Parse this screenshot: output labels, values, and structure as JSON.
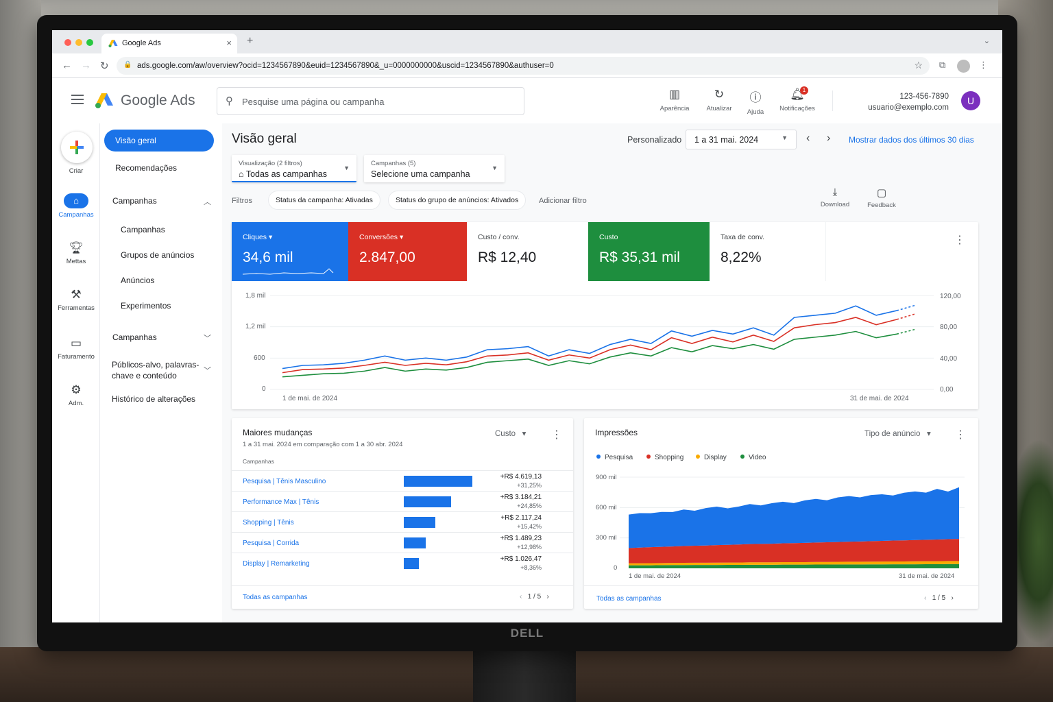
{
  "browser": {
    "tab_title": "Google Ads",
    "url": "ads.google.com/aw/overview?ocid=1234567890&euid=1234567890&_u=0000000000&uscid=1234567890&authuser=0"
  },
  "header": {
    "product": "Google Ads",
    "search_placeholder": "Pesquise uma página ou campanha",
    "buttons": [
      "Aparência",
      "Atualizar",
      "Ajuda",
      "Notificações"
    ],
    "notif_count": "1",
    "account_id": "123-456-7890",
    "account_email": "usuario@exemplo.com",
    "avatar_letter": "U"
  },
  "rail": {
    "create": "Criar",
    "items": [
      "Campanhas",
      "Mettas",
      "Ferramentas",
      "Faturamento",
      "Adm."
    ]
  },
  "nav": {
    "items": [
      "Visão geral",
      "Recomendações",
      "Campanhas",
      "Campanhas",
      "Grupos de anúncios",
      "Anúncios",
      "Experimentos",
      "Campanhas",
      "Públicos-alvo, palavras-",
      "chave e conteúdo",
      "Histórico de alterações"
    ]
  },
  "page": {
    "title": "Visão geral",
    "range_label": "Personalizado",
    "date_range": "1 a 31 mai. 2024",
    "last30": "Mostrar dados dos últimos 30 dias",
    "view_sub": "Visualização (2 filtros)",
    "view_val": "Todas as campanhas",
    "camp_sub": "Campanhas (5)",
    "camp_val": "Selecione uma campanha",
    "filters_label": "Filtros",
    "chip1": "Status da campanha: Ativadas",
    "chip2": "Status do grupo de anúncios: Ativados",
    "add_filter": "Adicionar filtro",
    "download": "Download",
    "feedback": "Feedback"
  },
  "metrics": [
    {
      "name": "Cliques",
      "value": "34,6 mil",
      "color": "#1a73e8"
    },
    {
      "name": "Conversões",
      "value": "2.847,00",
      "color": "#d93025"
    },
    {
      "name": "Custo / conv.",
      "value": "R$ 12,40",
      "color": "#ffffff"
    },
    {
      "name": "Custo",
      "value": "R$ 35,31 mil",
      "color": "#1e8e3e"
    },
    {
      "name": "Taxa de conv.",
      "value": "8,22%",
      "color": "#ffffff"
    }
  ],
  "chart_data": [
    {
      "type": "line",
      "x_start_label": "1 de mai. de 2024",
      "x_end_label": "31 de mai. de 2024",
      "y_left_ticks": [
        "0",
        "600",
        "1,2 mil",
        "1,8 mil"
      ],
      "y_right_ticks": [
        "0,00",
        "40,00",
        "80,00",
        "120,00"
      ],
      "ylim": [
        0,
        1800
      ],
      "series": [
        {
          "color": "#1a73e8",
          "values": [
            400,
            460,
            470,
            500,
            560,
            640,
            560,
            600,
            560,
            620,
            760,
            780,
            820,
            640,
            760,
            690,
            860,
            960,
            880,
            1120,
            1020,
            1130,
            1060,
            1180,
            1040,
            1380,
            1420,
            1460,
            1600,
            1420,
            1510
          ]
        },
        {
          "color": "#d93025",
          "values": [
            320,
            380,
            390,
            410,
            460,
            520,
            460,
            500,
            470,
            530,
            640,
            660,
            700,
            560,
            660,
            600,
            760,
            850,
            760,
            990,
            880,
            1000,
            910,
            1040,
            920,
            1180,
            1240,
            1280,
            1380,
            1240,
            1340
          ]
        },
        {
          "color": "#1e8e3e",
          "values": [
            240,
            270,
            300,
            310,
            350,
            420,
            350,
            390,
            370,
            420,
            520,
            550,
            580,
            460,
            550,
            490,
            620,
            700,
            640,
            800,
            720,
            840,
            780,
            860,
            770,
            960,
            1000,
            1040,
            1110,
            990,
            1060
          ]
        }
      ]
    },
    {
      "type": "area",
      "x_start_label": "1 de mai. de 2024",
      "x_end_label": "31 de mai. de 2024",
      "y_ticks": [
        "0",
        "300 mil",
        "600 mil",
        "900 mil"
      ],
      "ylim": [
        0,
        900
      ],
      "series": [
        {
          "name": "Video",
          "color": "#1e8e3e",
          "values": [
            30,
            30,
            30,
            31,
            32,
            32,
            33,
            33,
            33,
            34,
            34,
            35,
            35,
            35,
            36,
            36,
            36,
            37,
            37,
            38,
            38,
            38,
            39,
            39,
            40,
            40,
            40,
            41,
            41,
            42,
            42
          ]
        },
        {
          "name": "Display",
          "color": "#f9ab00",
          "values": [
            20,
            20,
            21,
            21,
            21,
            22,
            22,
            22,
            23,
            23,
            23,
            24,
            24,
            24,
            25,
            25,
            25,
            26,
            26,
            26,
            27,
            27,
            27,
            28,
            28,
            28,
            29,
            29,
            29,
            30,
            30
          ]
        },
        {
          "name": "Shopping",
          "color": "#d93025",
          "values": [
            150,
            155,
            158,
            160,
            163,
            166,
            168,
            170,
            173,
            175,
            178,
            180,
            182,
            184,
            186,
            188,
            190,
            192,
            194,
            196,
            198,
            200,
            202,
            204,
            206,
            208,
            210,
            212,
            214,
            216,
            218
          ]
        },
        {
          "name": "Pesquisa",
          "color": "#1a73e8",
          "values": [
            330,
            340,
            335,
            345,
            340,
            360,
            345,
            370,
            380,
            360,
            375,
            395,
            380,
            400,
            410,
            395,
            420,
            430,
            415,
            440,
            450,
            435,
            455,
            460,
            445,
            470,
            480,
            465,
            500,
            470,
            510
          ]
        }
      ]
    },
    {
      "type": "bar",
      "categories": [
        "Pesquisa | Tênis Masculino",
        "Performance Max | Tênis",
        "Shopping | Tênis",
        "Pesquisa | Corrida",
        "Display | Remarketing"
      ],
      "values": [
        4619.13,
        3184.21,
        2117.24,
        1489.23,
        1026.47
      ]
    }
  ],
  "changes": {
    "title": "Maiores mudanças",
    "subtitle": "1 a 31 mai. 2024 em comparação com 1 a 30 abr. 2024",
    "metric": "Custo",
    "col": "Campanhas",
    "rows": [
      {
        "name": "Pesquisa | Tênis Masculino",
        "amt": "+R$ 4.619,13",
        "pct": "+31,25%"
      },
      {
        "name": "Performance Max | Tênis",
        "amt": "+R$ 3.184,21",
        "pct": "+24,85%"
      },
      {
        "name": "Shopping | Tênis",
        "amt": "+R$ 2.117,24",
        "pct": "+15,42%"
      },
      {
        "name": "Pesquisa | Corrida",
        "amt": "+R$ 1.489,23",
        "pct": "+12,98%"
      },
      {
        "name": "Display | Remarketing",
        "amt": "+R$ 1.026,47",
        "pct": "+8,36%"
      }
    ],
    "all": "Todas as campanhas",
    "page": "1 / 5"
  },
  "impr": {
    "title": "Impressões",
    "dim": "Tipo de anúncio",
    "legend": [
      "Pesquisa",
      "Shopping",
      "Display",
      "Video"
    ],
    "all": "Todas as campanhas",
    "page": "1 / 5"
  },
  "brand": "DELL"
}
